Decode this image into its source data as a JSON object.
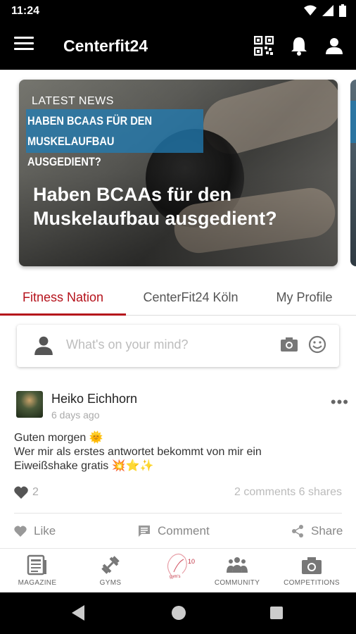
{
  "status_bar": {
    "time": "11:24"
  },
  "app_bar": {
    "title": "Centerfit24"
  },
  "news": {
    "section_label": "LATEST NEWS",
    "banner_line1": "Haben BCAAs für den",
    "banner_line2": "Muskelaufbau ausgedient?",
    "headline": "Haben BCAAs für den Muskelaufbau ausgedient?"
  },
  "tabs": [
    {
      "label": "Fitness Nation",
      "active": true
    },
    {
      "label": "CenterFit24 Köln",
      "active": false
    },
    {
      "label": "My Profile",
      "active": false
    }
  ],
  "composer": {
    "placeholder": "What's on your mind?"
  },
  "post": {
    "author": "Heiko Eichhorn",
    "time": "6 days ago",
    "line1": "Guten morgen 🌞",
    "line2": "Wer mir als erstes antwortet bekommt von mir ein",
    "line3": "Eiweißshake gratis 💥⭐✨",
    "like_count": "2",
    "comments_shares": "2 comments 6 shares",
    "like_label": "Like",
    "comment_label": "Comment",
    "share_label": "Share"
  },
  "bottom_nav": [
    {
      "label": "MAGAZINE",
      "icon": "magazine-icon"
    },
    {
      "label": "GYMS",
      "icon": "dumbbell-icon"
    },
    {
      "label": "",
      "icon": "brand-logo"
    },
    {
      "label": "COMMUNITY",
      "icon": "community-icon"
    },
    {
      "label": "COMPETITIONS",
      "icon": "camera-icon"
    }
  ],
  "colors": {
    "accent": "#b5121b",
    "app_bar": "#000000",
    "banner": "#207cb4"
  }
}
